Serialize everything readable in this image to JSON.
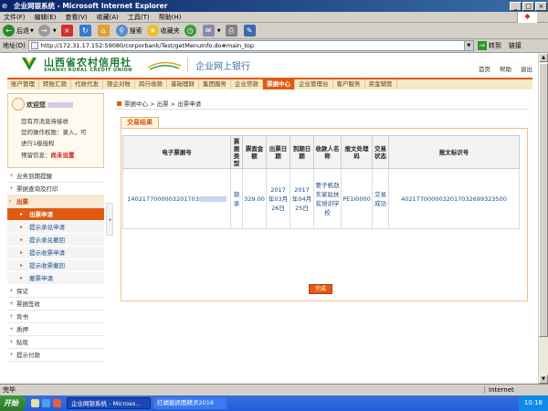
{
  "window": {
    "title": "企业网银系统 - Microsoft Internet Explorer",
    "min": "_",
    "max": "□",
    "close": "×"
  },
  "menubar": [
    "文件(F)",
    "编辑(E)",
    "查看(V)",
    "收藏(A)",
    "工具(T)",
    "帮助(H)"
  ],
  "toolbar": {
    "back": "后退",
    "search": "搜索",
    "favorites": "收藏夹"
  },
  "address": {
    "label": "地址(D)",
    "url": "http://172.31.17.152:59080/corporbank/Test/getMenuInfo.do#main_top",
    "go": "转到",
    "links": "链接"
  },
  "header": {
    "bank_name": "山西省农村信用社",
    "bank_en": "SHANXI RURAL CREDIT UNION",
    "subtitle": "企业网上银行",
    "right_links": [
      "首页",
      "帮助",
      "退出"
    ]
  },
  "nav": {
    "tabs": [
      "账户管理",
      "转账汇款",
      "代收代发",
      "银企对账",
      "跨行收款",
      "基础理财",
      "集团服务",
      "企业贷款",
      "票据中心",
      "企业管理台",
      "客户服务",
      "资金辅管"
    ],
    "active_index": 8
  },
  "user": {
    "welcome": "欢迎您",
    "lines": [
      "您有月消息待接收",
      "您的操作权限：录入，可",
      "进行1级授权",
      "预留信息："
    ],
    "reserved_value": "尚未设置"
  },
  "sidebar": {
    "items_before": [
      "业务到期提醒",
      "票据查询及打印"
    ],
    "open_item": "出票",
    "sub_items": [
      "出票申请",
      "提示承兑申请",
      "提示承兑撤回",
      "提示收票申请",
      "提示收票撤回",
      "撤票申请"
    ],
    "active_sub": 0,
    "items_after": [
      "保证",
      "票据签收",
      "背书",
      "质押",
      "贴现",
      "提示付款"
    ]
  },
  "breadcrumb": "票据中心 > 出票 > 出票申请",
  "result_tab": "交易结果",
  "table": {
    "headers": [
      "电子票据号",
      "票据类型",
      "票面金额",
      "出票日期",
      "到期日期",
      "收款人名称",
      "报文处理码",
      "交易状态",
      "报文标识号"
    ],
    "row": {
      "bill_no": "1402177000003201703",
      "bill_type": "银承",
      "amount": "329.00",
      "issue_date": "2017年03月26日",
      "due_date": "2017年04月25日",
      "payee": "要子帆劲东家驻扶贫培训学校",
      "proc_code": "PE1I0000",
      "status": "交易成功",
      "msg_id": "40217700000320170326993235​00"
    }
  },
  "done_button": "完成",
  "statusbar": {
    "left": "完毕",
    "zone": "Internet"
  },
  "taskbar": {
    "start": "开始",
    "items": [
      "企业网银系统 - Microso...",
      "红蜻蜓抓图精灵2016"
    ],
    "clock": "10:18"
  }
}
